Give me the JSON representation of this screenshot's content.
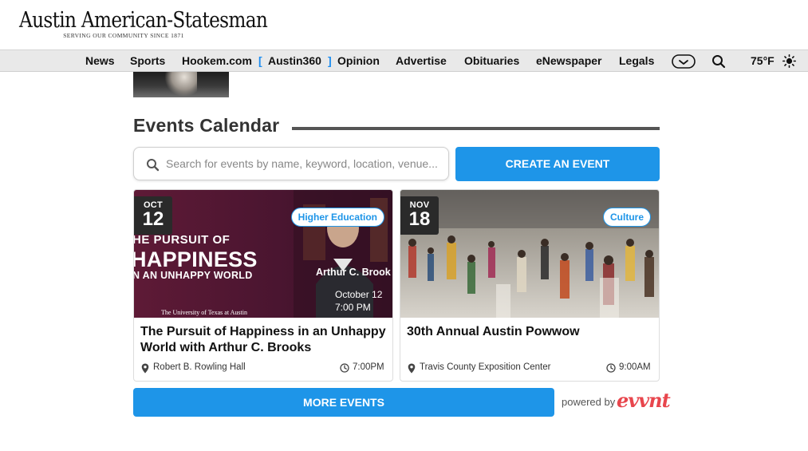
{
  "masthead": {
    "logo_title": "Austin American-Statesman",
    "logo_tagline": "SERVING OUR COMMUNITY SINCE 1871"
  },
  "nav": {
    "items": [
      "News",
      "Sports",
      "Hookem.com",
      "Austin360",
      "Opinion",
      "Advertise",
      "Obituaries",
      "eNewspaper",
      "Legals"
    ],
    "bracket_open": "[",
    "bracket_close": "]",
    "temperature": "75°F",
    "icons": [
      "globe-icon",
      "search-icon",
      "sun-icon"
    ]
  },
  "events": {
    "section_title": "Events Calendar",
    "search_placeholder": "Search for events by name, keyword, location, venue...",
    "create_label": "CREATE AN EVENT",
    "cards": [
      {
        "month": "OCT",
        "day": "12",
        "category": "Higher Education",
        "title": "The Pursuit of Happiness in an Unhappy World with Arthur C. Brooks",
        "venue": "Robert B. Rowling Hall",
        "time": "7:00PM",
        "image_text": {
          "line1": "HE PURSUIT OF",
          "line2": "HAPPINESS",
          "line3": "N AN UNHAPPY WORLD",
          "speaker": "Arthur C. Brook",
          "date_line": "October 12",
          "time_line": "7:00 PM",
          "institution": "The University of Texas at Austin"
        }
      },
      {
        "month": "NOV",
        "day": "18",
        "category": "Culture",
        "title": "30th Annual Austin Powwow",
        "venue": "Travis County Exposition Center",
        "time": "9:00AM"
      }
    ],
    "more_label": "MORE EVENTS",
    "powered_by": "powered by",
    "brand": "evvnt"
  },
  "colors": {
    "accent": "#1e95e8",
    "nav_bg": "#e9e9e9",
    "card1_bg": "#5a1a33",
    "brand_red": "#e8464d"
  }
}
